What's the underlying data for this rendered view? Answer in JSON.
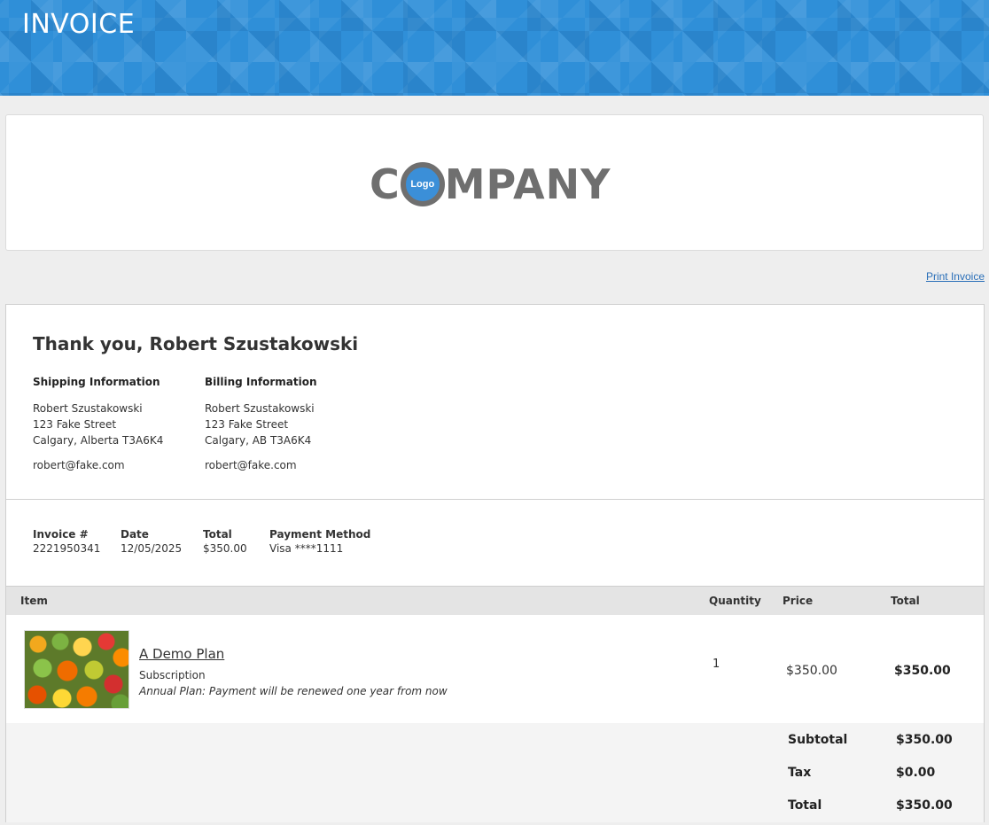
{
  "header": {
    "title": "INVOICE"
  },
  "logo": {
    "letters_before": "C",
    "circle_text": "Logo",
    "letters_after": "MPANY"
  },
  "actions": {
    "print_label": "Print Invoice"
  },
  "greeting": "Thank you, Robert Szustakowski",
  "shipping": {
    "heading": "Shipping Information",
    "name": "Robert Szustakowski",
    "street": "123 Fake Street",
    "city": "Calgary, Alberta T3A6K4",
    "email": "robert@fake.com"
  },
  "billing": {
    "heading": "Billing Information",
    "name": "Robert Szustakowski",
    "street": "123 Fake Street",
    "city": "Calgary, AB T3A6K4",
    "email": "robert@fake.com"
  },
  "meta": {
    "invoice_label": "Invoice #",
    "invoice_value": "2221950341",
    "date_label": "Date",
    "date_value": "12/05/2025",
    "total_label": "Total",
    "total_value": "$350.00",
    "payment_label": "Payment Method",
    "payment_value": "Visa ****1111"
  },
  "table": {
    "headers": {
      "item": "Item",
      "quantity": "Quantity",
      "price": "Price",
      "total": "Total"
    },
    "row": {
      "name": "A Demo Plan",
      "type": "Subscription",
      "note": "Annual Plan: Payment will be renewed one year from now",
      "quantity": "1",
      "price": "$350.00",
      "total": "$350.00"
    }
  },
  "summary": {
    "subtotal_label": "Subtotal",
    "subtotal_value": "$350.00",
    "tax_label": "Tax",
    "tax_value": "$0.00",
    "total_label": "Total",
    "total_value": "$350.00"
  },
  "colors": {
    "banner": "#2f8fd8",
    "link": "#2a6fb8",
    "logo_gray": "#6f6f6f",
    "logo_blue": "#3b8fd8"
  }
}
